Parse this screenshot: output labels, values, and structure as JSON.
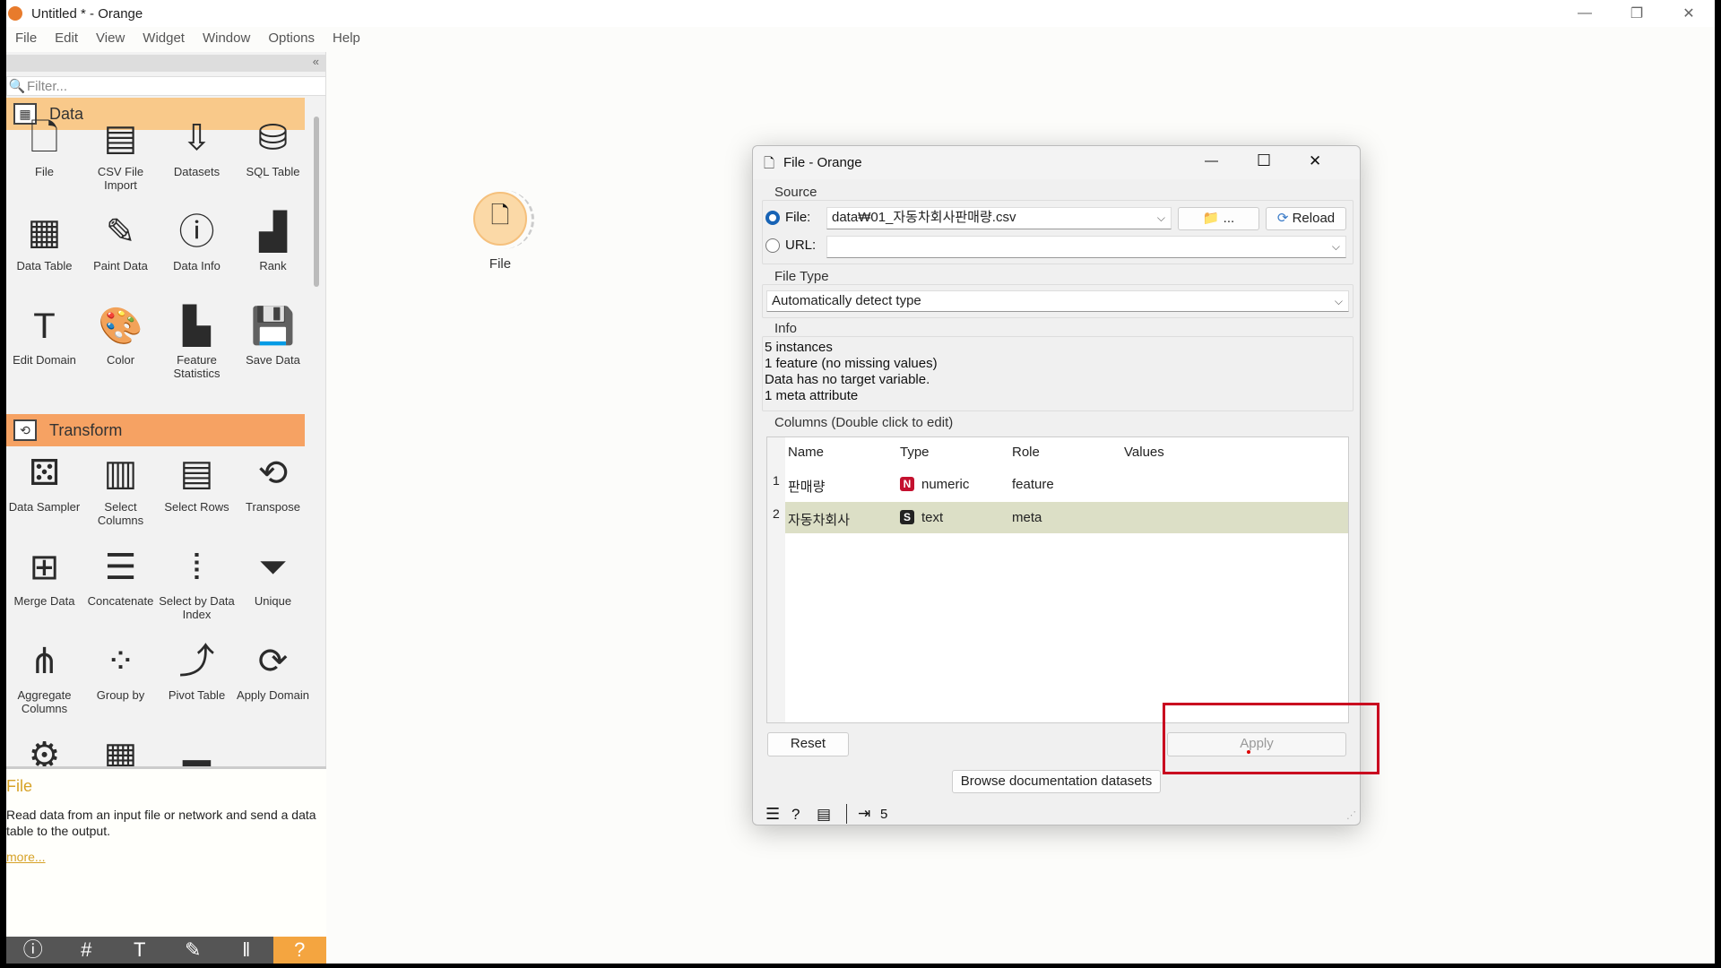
{
  "window": {
    "title": "Untitled * - Orange",
    "controls": [
      "—",
      "❐",
      "✕"
    ]
  },
  "menu": [
    "File",
    "Edit",
    "View",
    "Widget",
    "Window",
    "Options",
    "Help"
  ],
  "toolbox": {
    "collapse": "«",
    "filter_placeholder": "Filter...",
    "categories": [
      {
        "name": "Data",
        "color": "#f9c98a",
        "widgets": [
          {
            "label": "File",
            "icon": "file-icon",
            "glyph": "🗋"
          },
          {
            "label": "CSV File Import",
            "icon": "csv-icon",
            "glyph": "▤"
          },
          {
            "label": "Datasets",
            "icon": "datasets-icon",
            "glyph": "⇩"
          },
          {
            "label": "SQL Table",
            "icon": "database-icon",
            "glyph": "⛁"
          },
          {
            "label": "Data Table",
            "icon": "table-icon",
            "glyph": "▦"
          },
          {
            "label": "Paint Data",
            "icon": "paint-icon",
            "glyph": "✎"
          },
          {
            "label": "Data Info",
            "icon": "info-icon",
            "glyph": "ⓘ"
          },
          {
            "label": "Rank",
            "icon": "rank-icon",
            "glyph": "▟"
          },
          {
            "label": "Edit Domain",
            "icon": "edit-domain-icon",
            "glyph": "T"
          },
          {
            "label": "Color",
            "icon": "palette-icon",
            "glyph": "🎨"
          },
          {
            "label": "Feature Statistics",
            "icon": "statistics-icon",
            "glyph": "▙"
          },
          {
            "label": "Save Data",
            "icon": "save-icon",
            "glyph": "💾"
          }
        ]
      },
      {
        "name": "Transform",
        "color": "#f6a263",
        "widgets": [
          {
            "label": "Data Sampler",
            "icon": "sampler-icon",
            "glyph": "⚄"
          },
          {
            "label": "Select Columns",
            "icon": "select-columns-icon",
            "glyph": "▥"
          },
          {
            "label": "Select Rows",
            "icon": "select-rows-icon",
            "glyph": "▤"
          },
          {
            "label": "Transpose",
            "icon": "transpose-icon",
            "glyph": "⟲"
          },
          {
            "label": "Merge Data",
            "icon": "merge-icon",
            "glyph": "⊞"
          },
          {
            "label": "Concatenate",
            "icon": "concatenate-icon",
            "glyph": "☰"
          },
          {
            "label": "Select by Data Index",
            "icon": "index-icon",
            "glyph": "⦙"
          },
          {
            "label": "Unique",
            "icon": "funnel-icon",
            "glyph": "⏷"
          },
          {
            "label": "Aggregate Columns",
            "icon": "aggregate-icon",
            "glyph": "⋔"
          },
          {
            "label": "Group by",
            "icon": "group-by-icon",
            "glyph": "⁘"
          },
          {
            "label": "Pivot Table",
            "icon": "pivot-icon",
            "glyph": "⤴"
          },
          {
            "label": "Apply Domain",
            "icon": "apply-domain-icon",
            "glyph": "⟳"
          },
          {
            "label": "",
            "icon": "gear-icon",
            "glyph": "⚙"
          },
          {
            "label": "",
            "icon": "grid-icon",
            "glyph": "▦"
          },
          {
            "label": "",
            "icon": "bars-icon",
            "glyph": "▃"
          },
          {
            "label": "",
            "icon": "histogram-icon",
            "glyph": "▁"
          }
        ]
      }
    ]
  },
  "description": {
    "title": "File",
    "text": "Read data from an input file or network and send a data table to the output.",
    "more": "more..."
  },
  "bottom_toolbar": [
    "ⓘ",
    "#",
    "T",
    "✎",
    "‖",
    "?"
  ],
  "canvas": {
    "node_label": "File"
  },
  "dialog": {
    "title": "File - Orange",
    "controls": [
      "—",
      "☐",
      "✕"
    ],
    "source_label": "Source",
    "file_label": "File:",
    "file_value": "data₩01_자동차회사판매량.csv",
    "browse_button": "📁 ...",
    "reload_button": "Reload",
    "url_label": "URL:",
    "url_value": "",
    "file_type_label": "File Type",
    "file_type_value": "Automatically detect type",
    "info_label": "Info",
    "info_lines": [
      "5 instances",
      "1 feature (no missing values)",
      "Data has no target variable.",
      "1 meta attribute"
    ],
    "columns_label": "Columns (Double click to edit)",
    "columns_headers": [
      "Name",
      "Type",
      "Role",
      "Values"
    ],
    "rows": [
      {
        "n": "1",
        "name": "판매량",
        "badge": "N",
        "badge_color": "#c4112f",
        "type": "numeric",
        "role": "feature",
        "values": ""
      },
      {
        "n": "2",
        "name": "자동차회사",
        "badge": "S",
        "badge_color": "#222222",
        "type": "text",
        "role": "meta",
        "values": ""
      }
    ],
    "selected_row_color": "#dcdfc6",
    "reset_button": "Reset",
    "apply_button": "Apply",
    "browse_docs_button": "Browse documentation datasets",
    "status_output_count": "5"
  },
  "highlight_color": "#c9001f"
}
